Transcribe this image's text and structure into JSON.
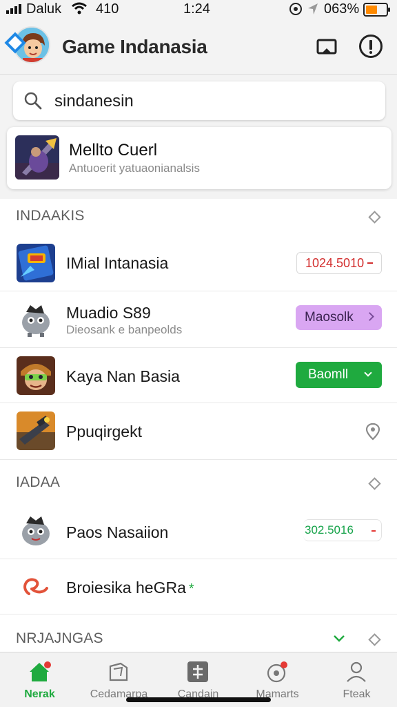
{
  "status_bar": {
    "carrier": "Daluk",
    "network": "410",
    "time": "1:24",
    "battery_pct": "063%",
    "battery_color": "#ff8a00"
  },
  "header": {
    "title": "Game Indanasia",
    "cast_icon": "cast-icon",
    "info_icon": "info-icon"
  },
  "search": {
    "value": "sindanesin",
    "icon": "search-icon"
  },
  "suggestion": {
    "title": "Mellto Cuerl",
    "subtitle": "Antuoerit yatuaonianalsis"
  },
  "sections": [
    {
      "title": "INDAAKIS",
      "items": [
        {
          "title": "IMial Intanasia",
          "subtitle": "",
          "action": "1024.5010"
        },
        {
          "title": "Muadio S89",
          "subtitle": "Dieosank e banpeolds",
          "action": "Maosolk"
        },
        {
          "title": "Kaya Nan Basia",
          "subtitle": "",
          "action": "Baomll"
        },
        {
          "title": "Ppuqirgekt",
          "subtitle": "",
          "action": ""
        }
      ]
    },
    {
      "title": "IADAA",
      "items": [
        {
          "title": "Paos Nasaiion",
          "subtitle": "",
          "action": "302.5016"
        },
        {
          "title": "Broiesika heGRa",
          "subtitle": "",
          "action": ""
        }
      ]
    },
    {
      "title": "NRJAJNGAS",
      "items": []
    }
  ],
  "bottom_nav": [
    {
      "label": "Nerak",
      "icon": "home-icon",
      "active": true
    },
    {
      "label": "Cedamarpa",
      "icon": "box-icon",
      "active": false
    },
    {
      "label": "Candain",
      "icon": "sliders-icon",
      "active": false
    },
    {
      "label": "Mamarts",
      "icon": "alert-circle-icon",
      "active": false
    },
    {
      "label": "Fteak",
      "icon": "profile-icon",
      "active": false
    }
  ],
  "colors": {
    "accent_green": "#1faa3f",
    "accent_red": "#d32f2f",
    "accent_purple": "#d9a6f2",
    "brand_blue": "#1e88e5"
  }
}
